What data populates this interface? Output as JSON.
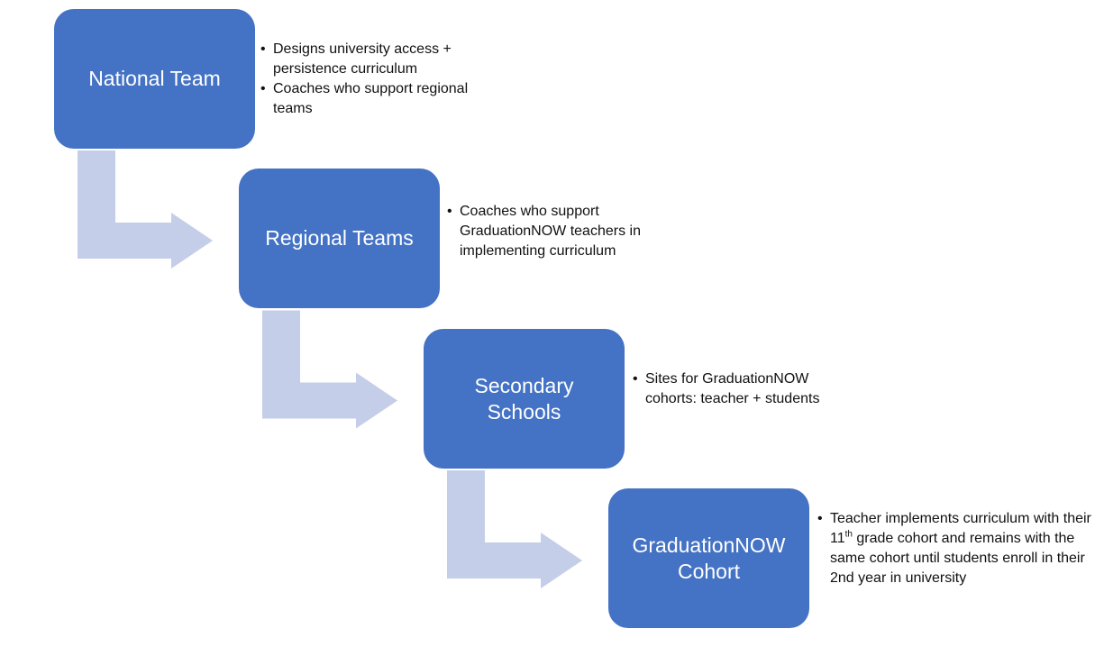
{
  "colors": {
    "box": "#4472C4",
    "arrow": "#C5CEE8",
    "box_text": "#FFFFFF"
  },
  "levels": [
    {
      "title": "National Team",
      "notes": [
        "Designs university access + persistence curriculum",
        "Coaches who support regional teams"
      ]
    },
    {
      "title": "Regional Teams",
      "notes": [
        "Coaches who support GraduationNOW teachers in implementing curriculum"
      ]
    },
    {
      "title": "Secondary Schools",
      "notes": [
        "Sites for GraduationNOW cohorts: teacher + students"
      ]
    },
    {
      "title": "GraduationNOW Cohort",
      "notes_parts": {
        "a": "Teacher implements curriculum with their 11",
        "sup": "th",
        "b": " grade cohort and remains with the same cohort until students enroll in their 2nd year in university"
      }
    }
  ]
}
